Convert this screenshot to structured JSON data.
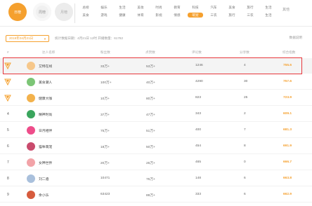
{
  "top_tabs": [
    {
      "label": "日榜"
    },
    {
      "label": "周榜"
    },
    {
      "label": "月榜"
    }
  ],
  "categories": [
    {
      "label": "总榜"
    },
    {
      "label": "娱乐"
    },
    {
      "label": "生活"
    },
    {
      "label": "美妆"
    },
    {
      "label": "时尚"
    },
    {
      "label": "教育"
    },
    {
      "label": "科技"
    },
    {
      "label": "汽车"
    },
    {
      "label": "美食"
    },
    {
      "label": "游戏"
    },
    {
      "label": "健康"
    },
    {
      "label": "体育"
    },
    {
      "label": "影视"
    },
    {
      "label": "情感"
    },
    {
      "label": "萌宠"
    },
    {
      "label": "三农"
    },
    {
      "label": "旅行"
    },
    {
      "label": "生活"
    }
  ],
  "more": {
    "row1": "其他",
    "row2": ""
  },
  "filter": {
    "date": "2019年04月21日",
    "updated": "统计数据日期：4月21日 12时  开播数量：61782",
    "export": "数据说明"
  },
  "columns": {
    "rank": "#",
    "name": "达人名称",
    "c1": "粉丝数",
    "c2": "点赞数",
    "c3": "评论数",
    "c4": "分享数",
    "score": "综合指数"
  },
  "rows": [
    {
      "rank": "1",
      "name": "艾特在线",
      "c1": "33万+",
      "c2": "53万+",
      "c3": "1246",
      "c4": "4",
      "score": "755.6"
    },
    {
      "rank": "2",
      "name": "美食潮人",
      "c1": "100万+",
      "c2": "40万+",
      "c3": "4290",
      "c4": "30",
      "score": "757.6"
    },
    {
      "rank": "3",
      "name": "健康大咖",
      "c1": "10万+",
      "c2": "80万+",
      "c3": "823",
      "c4": "25",
      "score": "723.9"
    },
    {
      "rank": "4",
      "name": "精神时尚",
      "c1": "37万+",
      "c2": "47万+",
      "c3": "343",
      "c4": "2",
      "score": "609.1"
    },
    {
      "rank": "5",
      "name": "日月相伴",
      "c1": "75万+",
      "c2": "51万+",
      "c3": "400",
      "c4": "7",
      "score": "681.3"
    },
    {
      "rank": "6",
      "name": "猫咪萌宠",
      "c1": "18万+",
      "c2": "50万+",
      "c3": "454",
      "c4": "8",
      "score": "691.9"
    },
    {
      "rank": "7",
      "name": "女神世界",
      "c1": "20万+",
      "c2": "25万+",
      "c3": "465",
      "c4": "0",
      "score": "666.7"
    },
    {
      "rank": "8",
      "name": "刘二骆",
      "c1": "10471",
      "c2": "75万+",
      "c3": "148",
      "c4": "6",
      "score": "663.8"
    },
    {
      "rank": "9",
      "name": "余小乐",
      "c1": "63423",
      "c2": "89万+",
      "c3": "333",
      "c4": "6",
      "score": "662.9"
    }
  ],
  "colors": {
    "accent": "#f5a02e",
    "highlight_border": "#e8373c"
  }
}
